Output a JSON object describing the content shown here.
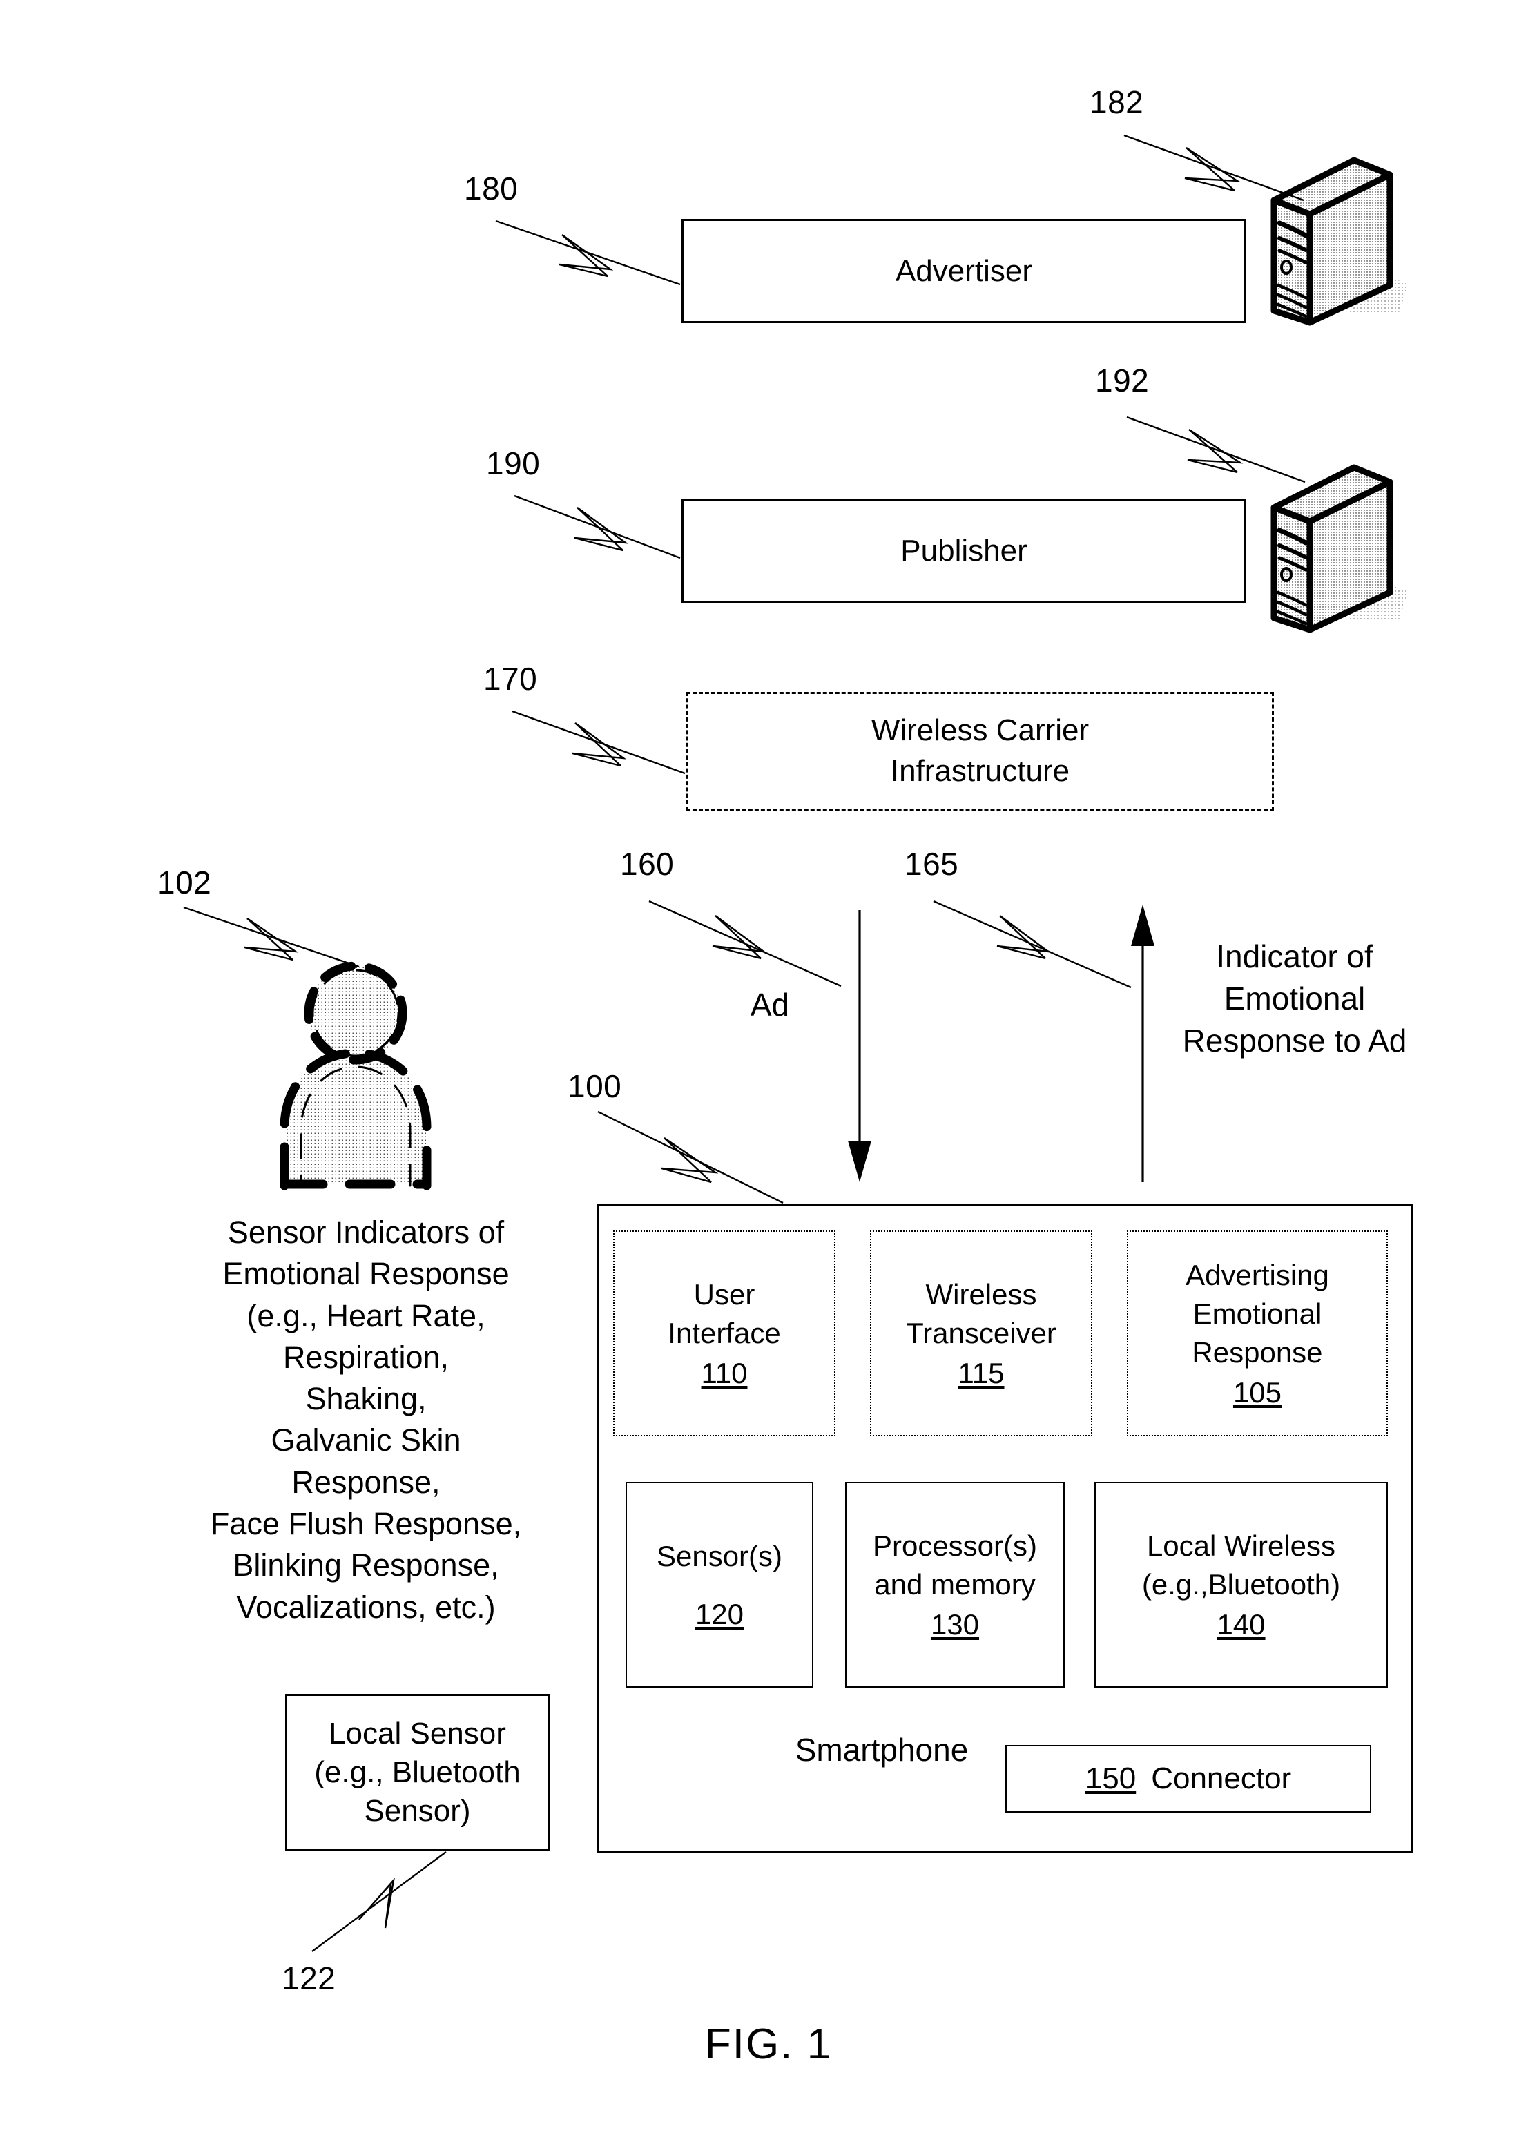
{
  "figure": {
    "caption": "FIG. 1"
  },
  "nodes": {
    "advertiser": {
      "label": "Advertiser",
      "ref": "180"
    },
    "advertiser_server": {
      "ref": "182",
      "icon": "server-tower-icon"
    },
    "publisher": {
      "label": "Publisher",
      "ref": "190"
    },
    "publisher_server": {
      "ref": "192",
      "icon": "server-tower-icon"
    },
    "wireless_carrier": {
      "label": "Wireless Carrier\nInfrastructure",
      "ref": "170"
    },
    "person": {
      "ref": "102",
      "icon": "person-silhouette-icon"
    },
    "local_sensor": {
      "label": "Local Sensor\n(e.g., Bluetooth\nSensor)",
      "ref": "122"
    },
    "smartphone": {
      "label": "Smartphone",
      "ref": "100"
    }
  },
  "flows": {
    "ad": {
      "label": "Ad",
      "ref": "160",
      "direction": "down"
    },
    "response": {
      "label": "Indicator of\nEmotional\nResponse to Ad",
      "ref": "165",
      "direction": "up"
    }
  },
  "sensor_text": "Sensor Indicators of\nEmotional Response\n(e.g., Heart Rate,\nRespiration,\nShaking,\nGalvanic Skin\nResponse,\nFace Flush Response,\nBlinking Response,\nVocalizations, etc.)",
  "smartphone_modules": [
    {
      "label": "User\nInterface",
      "ref": "110"
    },
    {
      "label": "Wireless\nTransceiver",
      "ref": "115"
    },
    {
      "label": "Advertising\nEmotional\nResponse",
      "ref": "105"
    },
    {
      "label": "Sensor(s)",
      "ref": "120"
    },
    {
      "label": "Processor(s)\nand memory",
      "ref": "130"
    },
    {
      "label": "Local Wireless\n(e.g.,Bluetooth)",
      "ref": "140"
    }
  ],
  "connector": {
    "ref": "150",
    "label": "Connector"
  },
  "colors": {
    "ink": "#000000",
    "paper": "#ffffff"
  }
}
